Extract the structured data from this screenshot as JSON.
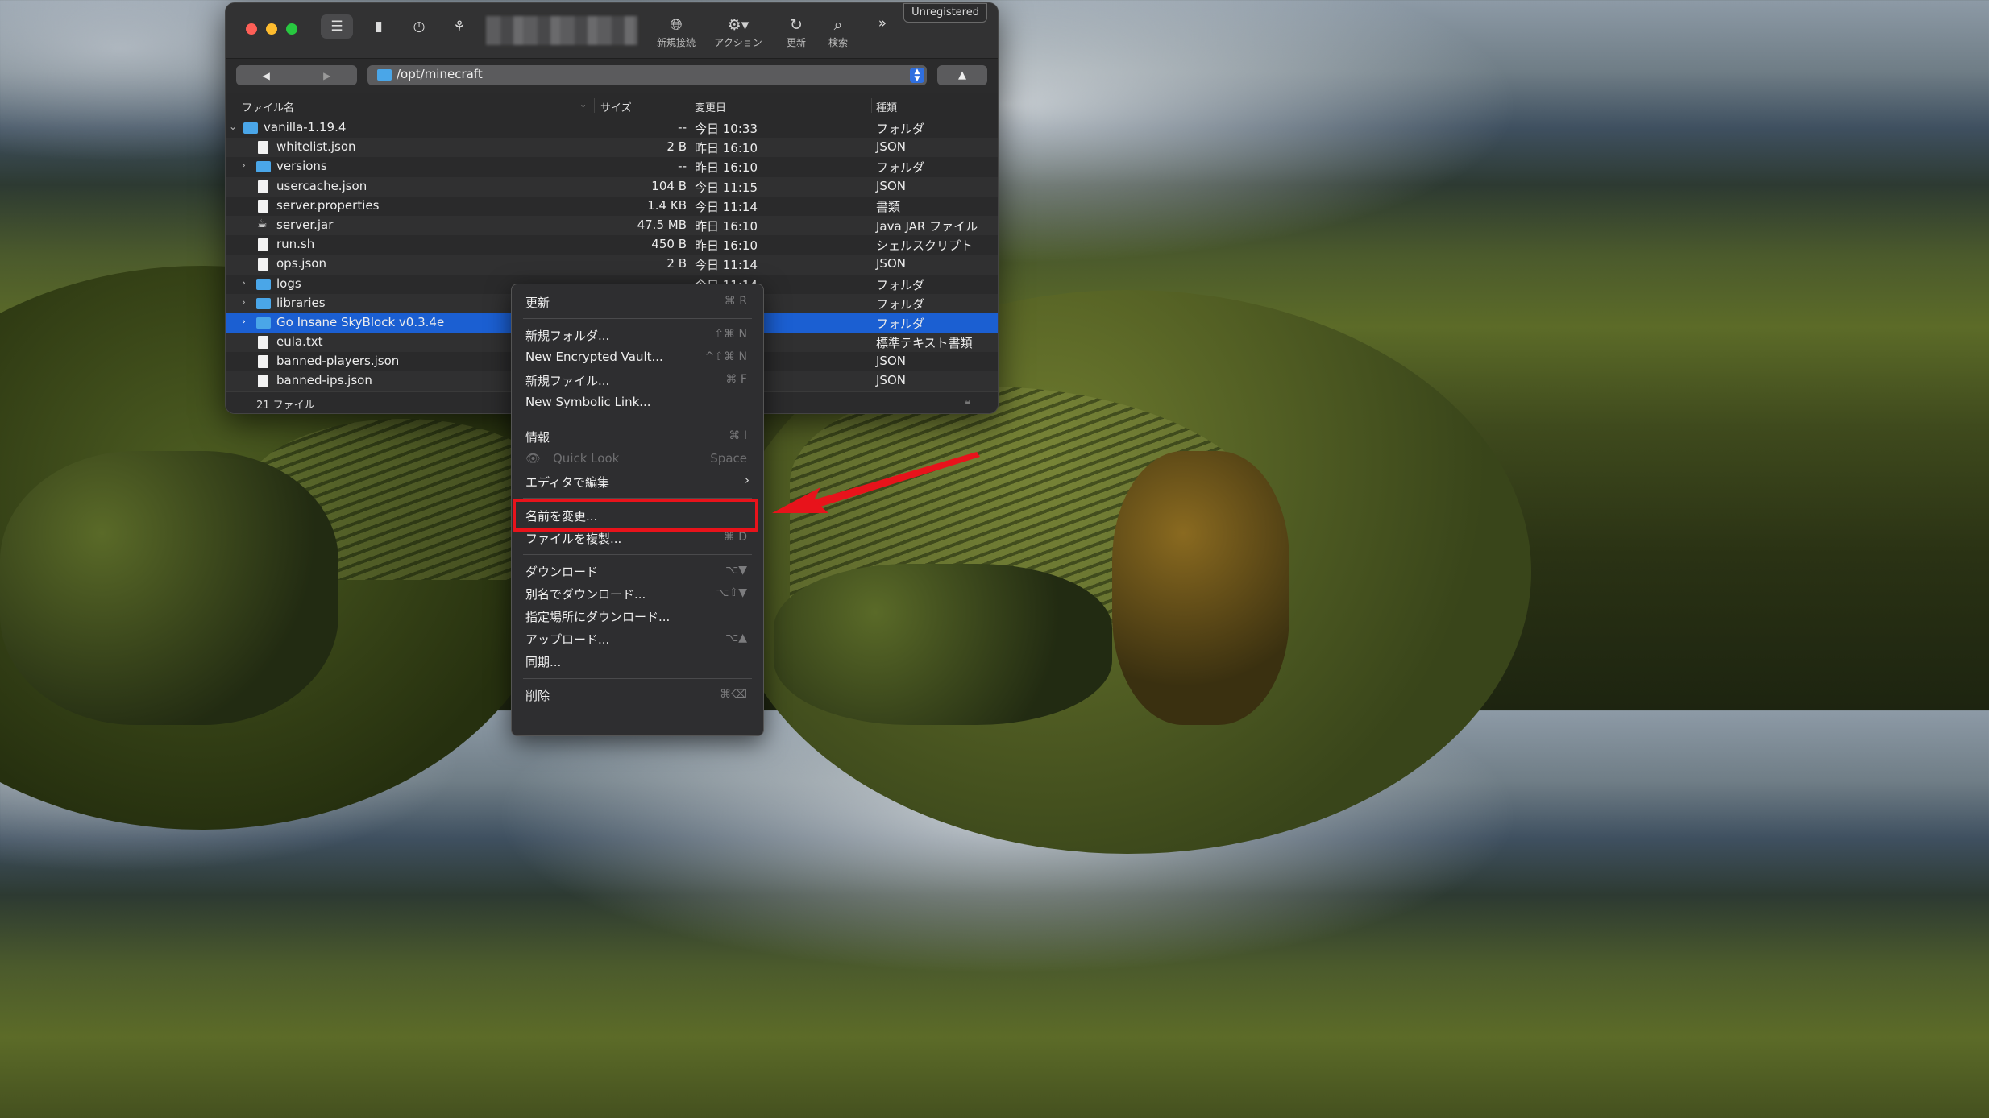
{
  "window": {
    "unregistered": "Unregistered",
    "toolbar": [
      {
        "icon": "globe-plus-icon",
        "label": "新規接続"
      },
      {
        "icon": "gear-icon",
        "label": "アクション"
      },
      {
        "icon": "refresh-icon",
        "label": "更新"
      },
      {
        "icon": "search-icon",
        "label": "検索"
      }
    ],
    "path": "/opt/minecraft",
    "columns": {
      "name": "ファイル名",
      "size": "サイズ",
      "modified": "変更日",
      "kind": "種類"
    },
    "files": [
      {
        "name": "vanilla-1.19.4",
        "size": "--",
        "date": "今日 10:33",
        "kind": "フォルダ"
      },
      {
        "name": "whitelist.json",
        "size": "2 B",
        "date": "昨日 16:10",
        "kind": "JSON"
      },
      {
        "name": "versions",
        "size": "--",
        "date": "昨日 16:10",
        "kind": "フォルダ"
      },
      {
        "name": "usercache.json",
        "size": "104 B",
        "date": "今日 11:15",
        "kind": "JSON"
      },
      {
        "name": "server.properties",
        "size": "1.4 KB",
        "date": "今日 11:14",
        "kind": "書類"
      },
      {
        "name": "server.jar",
        "size": "47.5 MB",
        "date": "昨日 16:10",
        "kind": "Java JAR ファイル"
      },
      {
        "name": "run.sh",
        "size": "450 B",
        "date": "昨日 16:10",
        "kind": "シェルスクリプト"
      },
      {
        "name": "ops.json",
        "size": "2 B",
        "date": "今日 11:14",
        "kind": "JSON"
      },
      {
        "name": "logs",
        "size": "--",
        "date": "今日 11:14",
        "kind": "フォルダ"
      },
      {
        "name": "libraries",
        "size": "",
        "date": "",
        "kind": "フォルダ"
      },
      {
        "name": "Go Insane SkyBlock v0.3.4e",
        "size": "",
        "date": "",
        "kind": "フォルダ"
      },
      {
        "name": "eula.txt",
        "size": "",
        "date": "",
        "kind": "標準テキスト書類"
      },
      {
        "name": "banned-players.json",
        "size": "",
        "date": "",
        "kind": "JSON"
      },
      {
        "name": "banned-ips.json",
        "size": "",
        "date": "",
        "kind": "JSON"
      }
    ],
    "status": "21 ファイル"
  },
  "menu": {
    "items": [
      {
        "label": "更新",
        "shortcut": "⌘ R"
      },
      {
        "label": "新規フォルダ...",
        "shortcut": "⇧⌘ N"
      },
      {
        "label": "New Encrypted Vault...",
        "shortcut": "^⇧⌘ N"
      },
      {
        "label": "新規ファイル...",
        "shortcut": "⌘ F"
      },
      {
        "label": "New Symbolic Link...",
        "shortcut": ""
      },
      {
        "label": "情報",
        "shortcut": "⌘ I"
      },
      {
        "label": "Quick Look",
        "shortcut": "Space"
      },
      {
        "label": "エディタで編集",
        "shortcut": ""
      },
      {
        "label": "名前を変更...",
        "shortcut": ""
      },
      {
        "label": "ファイルを複製...",
        "shortcut": "⌘ D"
      },
      {
        "label": "ダウンロード",
        "shortcut": "⌥▼"
      },
      {
        "label": "別名でダウンロード...",
        "shortcut": "⌥⇧▼"
      },
      {
        "label": "指定場所にダウンロード...",
        "shortcut": ""
      },
      {
        "label": "アップロード...",
        "shortcut": "⌥▲"
      },
      {
        "label": "同期...",
        "shortcut": ""
      },
      {
        "label": "削除",
        "shortcut": "⌘⌫"
      }
    ]
  },
  "colors": {
    "selection": "#1b5fd2",
    "highlight_box": "#e8131b",
    "folder": "#4aa6e8"
  }
}
